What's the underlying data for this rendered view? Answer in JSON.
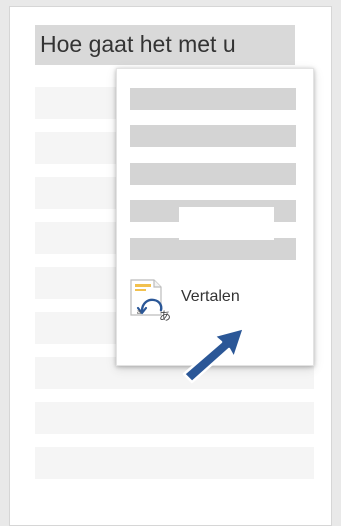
{
  "document": {
    "selected_text": "Hoe gaat het met u"
  },
  "context_menu": {
    "translate_label": "Vertalen",
    "translate_icon": "translate-icon"
  },
  "colors": {
    "selection": "#d9d9d9",
    "menu_placeholder": "#d4d4d4",
    "arrow": "#2b5797",
    "icon_accent": "#f2c14e"
  }
}
